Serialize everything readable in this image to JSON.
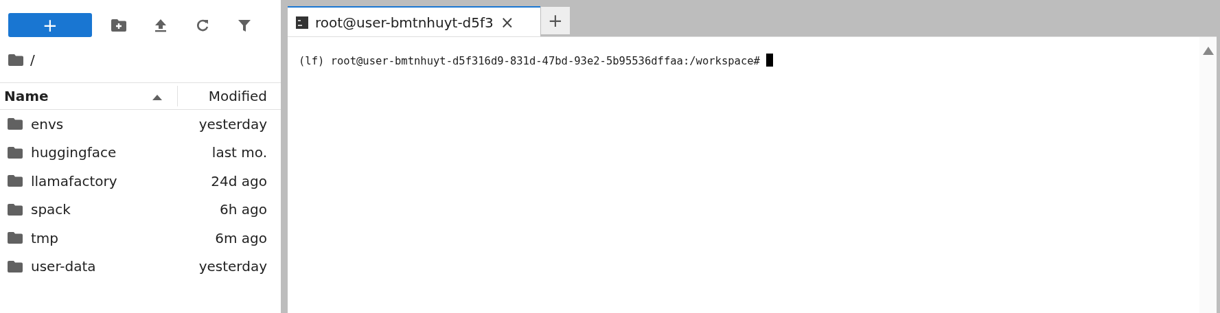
{
  "toolbar": {
    "new_button": "+"
  },
  "breadcrumb": {
    "path": "/"
  },
  "file_list": {
    "columns": [
      {
        "label": "Name",
        "sorted": true
      },
      {
        "label": "Modified",
        "sorted": false
      }
    ],
    "rows": [
      {
        "name": "envs",
        "modified": "yesterday"
      },
      {
        "name": "huggingface",
        "modified": "last mo."
      },
      {
        "name": "llamafactory",
        "modified": "24d ago"
      },
      {
        "name": "spack",
        "modified": "6h ago"
      },
      {
        "name": "tmp",
        "modified": "6m ago"
      },
      {
        "name": "user-data",
        "modified": "yesterday"
      }
    ]
  },
  "tabs": [
    {
      "label": "root@user-bmtnhuyt-d5f3",
      "selected": true,
      "close": "×"
    }
  ],
  "new_tab": "+",
  "terminal": {
    "lines": [
      "(lf) root@user-bmtnhuyt-d5f316d9-831d-47bd-93e2-5b95536dffaa:/workspace# "
    ]
  }
}
